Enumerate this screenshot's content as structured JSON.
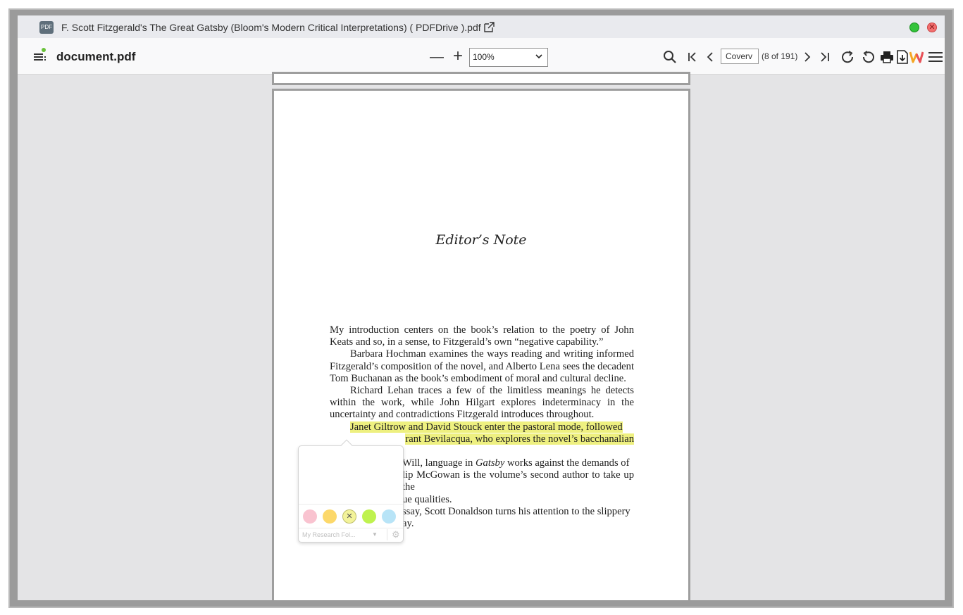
{
  "titlebar": {
    "badge": "PDF",
    "title": "F. Scott Fitzgerald's The Great Gatsby (Bloom's Modern Critical Interpretations) ( PDFDrive ).pdf",
    "close_glyph": "✕"
  },
  "toolbar": {
    "doc_name": "document.pdf",
    "zoom_out": "—",
    "zoom_in": "+",
    "zoom_value": "100%",
    "page_input": "Coverv",
    "page_count": "(8 of 191)",
    "icons": [
      "menu-icon",
      "zoom-out-icon",
      "zoom-in-icon",
      "search-icon",
      "first-page-icon",
      "prev-page-icon",
      "next-page-icon",
      "last-page-icon",
      "rotate-cw-icon",
      "rotate-ccw-icon",
      "print-icon",
      "download-icon",
      "w-logo-icon",
      "hamburger-icon"
    ]
  },
  "page": {
    "heading": "Editor’s Note",
    "paragraphs": [
      {
        "indent": false,
        "highlight": false,
        "text": "My introduction centers on the book’s relation to the poetry of John Keats and so, in a sense, to Fitzgerald’s own “negative capability.”"
      },
      {
        "indent": true,
        "highlight": false,
        "text": "Barbara Hochman examines the ways reading and writing informed Fitzgerald’s composition of the novel, and Alberto Lena sees the decadent Tom Buchanan as the book’s embodiment of moral and cultural decline."
      },
      {
        "indent": true,
        "highlight": false,
        "text": "Richard Lehan traces a few of the limitless meanings he detects within the work, while John Hilgart explores indeterminacy in the uncertainty and contradictions Fitzgerald introduces throughout."
      }
    ],
    "highlight_line1": "Janet Giltrow and David Stouck enter the pastoral mode, followed",
    "highlight_line2": "rant Bevilacqua, who explores the novel’s bacchanalian",
    "partial_lines": [
      {
        "text_a": "Will, language in ",
        "italic": "Gatsby",
        "text_b": " works against the demands of"
      },
      {
        "text_a": "lip McGowan is the volume’s second author to take up the",
        "italic": "",
        "text_b": ""
      },
      {
        "text_a": "ue qualities.",
        "italic": "",
        "text_b": ""
      },
      {
        "text_a": "ssay, Scott Donaldson turns his attention to the slippery",
        "italic": "",
        "text_b": ""
      },
      {
        "text_a": "ay.",
        "italic": "",
        "text_b": ""
      }
    ]
  },
  "popup": {
    "colors": [
      "#f9c3d0",
      "#fcd86a",
      "#f3f39a",
      "#bff24f",
      "#b8e4f7"
    ],
    "remove_glyph": "✕",
    "folder_label": "My Research Fol...",
    "folder_chevron": "▼",
    "gear_glyph": "⚙"
  }
}
